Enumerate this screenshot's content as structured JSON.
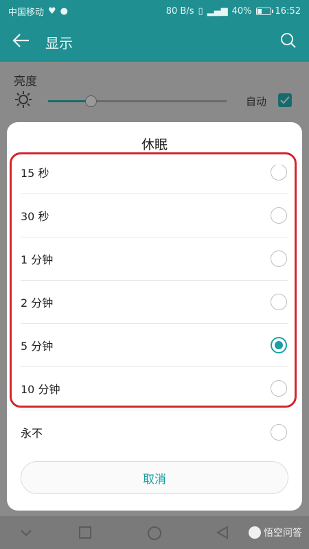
{
  "status_bar": {
    "carrier": "中国移动",
    "speed": "80 B/s",
    "battery": "40%",
    "battery_level": 0.4,
    "time": "16:52"
  },
  "app_bar": {
    "title": "显示",
    "back_icon": "arrow-left-icon",
    "search_icon": "search-icon"
  },
  "background": {
    "brightness_label": "亮度",
    "brightness_level": 0.24,
    "auto_label": "自动",
    "auto_checked": true
  },
  "dialog": {
    "title": "休眠",
    "options": [
      {
        "label": "15 秒",
        "checked": false
      },
      {
        "label": "30 秒",
        "checked": false
      },
      {
        "label": "1 分钟",
        "checked": false
      },
      {
        "label": "2 分钟",
        "checked": false
      },
      {
        "label": "5 分钟",
        "checked": true
      },
      {
        "label": "10 分钟",
        "checked": false
      },
      {
        "label": "永不",
        "checked": false
      }
    ],
    "cancel_label": "取消"
  },
  "watermark": {
    "text": "悟空问答"
  },
  "colors": {
    "accent": "#1a9fa3",
    "header": "#1f8f91",
    "highlight": "#d3252e"
  }
}
